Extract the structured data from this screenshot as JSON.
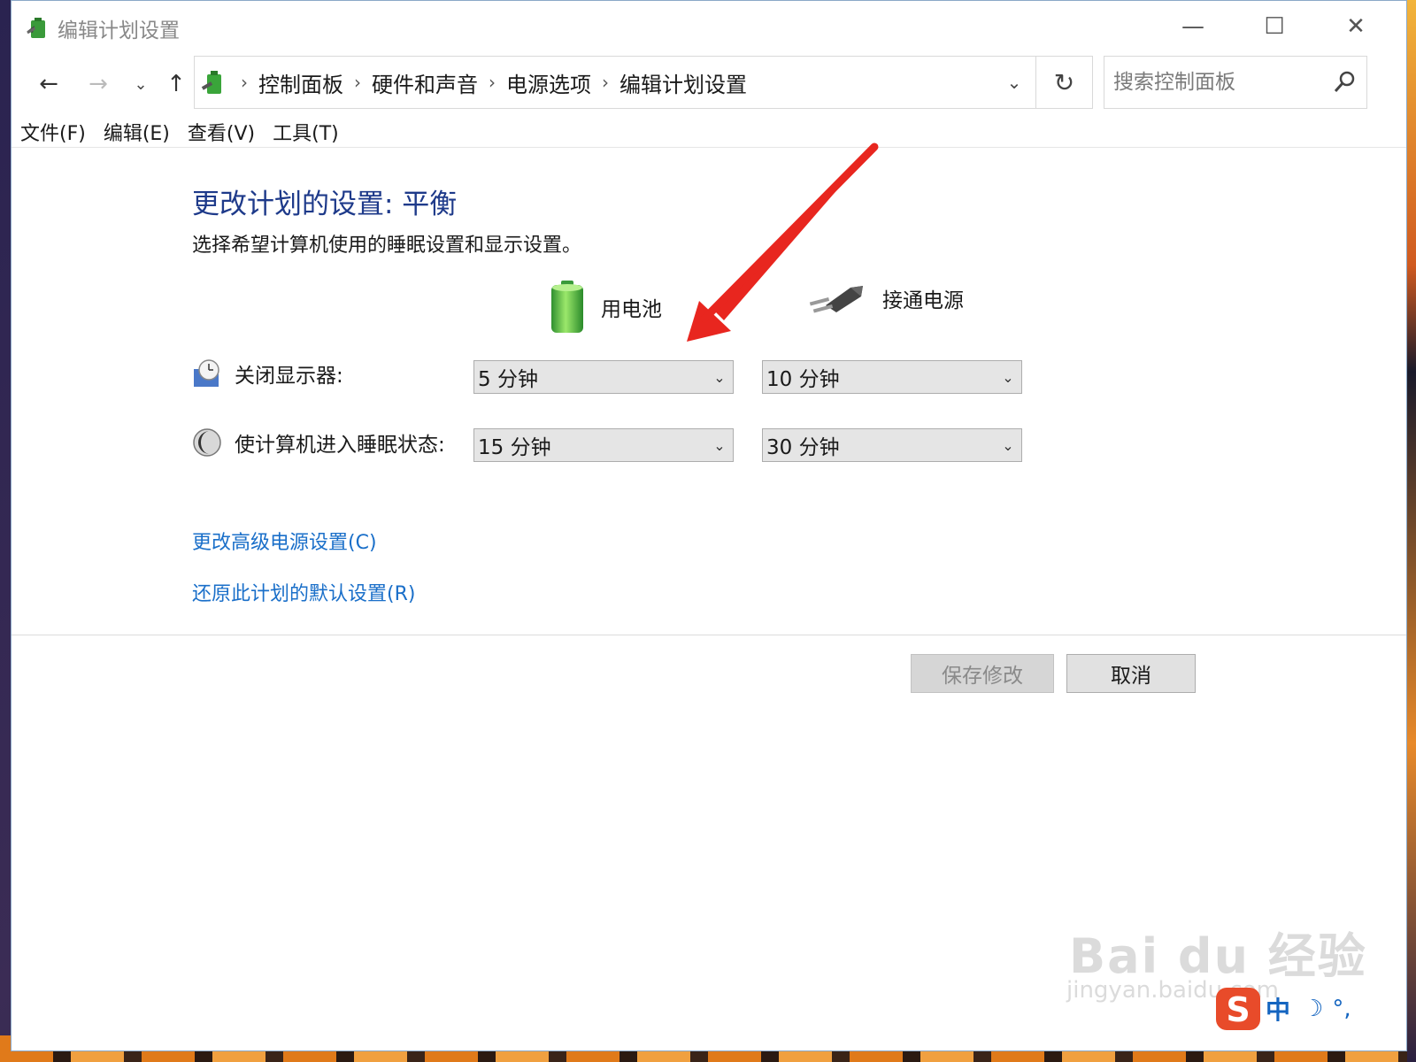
{
  "window": {
    "title": "编辑计划设置",
    "controls": {
      "minimize": "—",
      "maximize": "☐",
      "close": "✕"
    }
  },
  "nav": {
    "back": "←",
    "forward": "→",
    "recent": "⌄",
    "up": "↑",
    "breadcrumb": [
      "控制面板",
      "硬件和声音",
      "电源选项",
      "编辑计划设置"
    ],
    "separator": "›",
    "dropdown": "⌄",
    "refresh": "↻"
  },
  "search": {
    "placeholder": "搜索控制面板",
    "value": ""
  },
  "menubar": {
    "items": [
      "文件(F)",
      "编辑(E)",
      "查看(V)",
      "工具(T)"
    ]
  },
  "content": {
    "title": "更改计划的设置: 平衡",
    "subtitle": "选择希望计算机使用的睡眠设置和显示设置。",
    "columns": {
      "battery": "用电池",
      "plugged_in": "接通电源"
    },
    "settings": [
      {
        "label": "关闭显示器:",
        "battery": "5 分钟",
        "plugged_in": "10 分钟",
        "icon": "monitor-clock-icon"
      },
      {
        "label": "使计算机进入睡眠状态:",
        "battery": "15 分钟",
        "plugged_in": "30 分钟",
        "icon": "sleep-moon-icon"
      }
    ],
    "links": {
      "advanced": "更改高级电源设置(C)",
      "restore": "还原此计划的默认设置(R)"
    }
  },
  "buttons": {
    "save": "保存修改",
    "cancel": "取消"
  },
  "watermark": {
    "text": "Bai du 经验",
    "url": "jingyan.baidu.com"
  },
  "ime": {
    "mode": "中",
    "moon": "☽",
    "punct": "°,"
  },
  "colors": {
    "title": "#1e3a8a",
    "link": "#1a6fc9",
    "annotation": "#e8261f",
    "ime": "#1565c0"
  },
  "icons": [
    "power-options-icon",
    "battery-icon",
    "plug-icon",
    "search-icon",
    "refresh-icon"
  ]
}
